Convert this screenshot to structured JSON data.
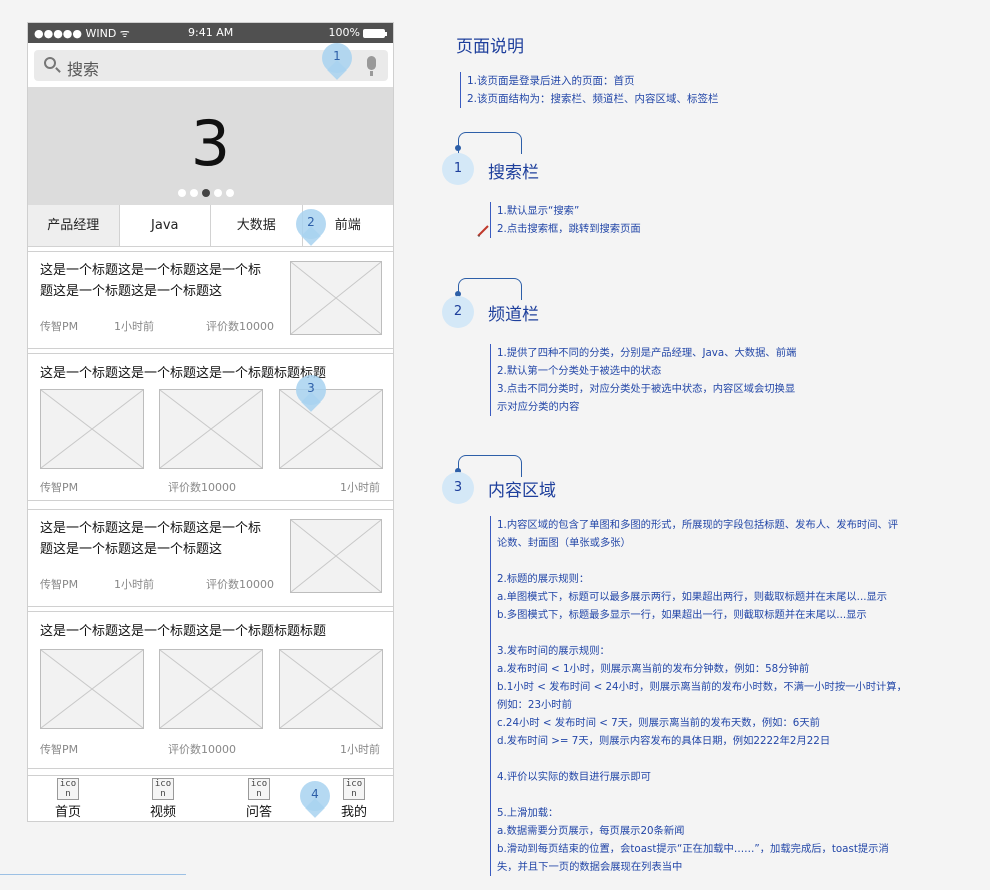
{
  "status_bar": {
    "carrier": "●●●●● WIND ᯤ",
    "time": "9:41 AM",
    "battery": "100%"
  },
  "search": {
    "placeholder": "搜索"
  },
  "banner": {
    "number": "3",
    "dots_total": 5,
    "active_dot": 2
  },
  "tabs": [
    {
      "label": "产品经理",
      "active": true
    },
    {
      "label": "Java",
      "active": false
    },
    {
      "label": "大数据",
      "active": false
    },
    {
      "label": "前端",
      "active": false
    }
  ],
  "cards": [
    {
      "type": "single",
      "title_line1": "这是一个标题这是一个标题这是一个标",
      "title_line2": "题这是一个标题这是一个标题这",
      "author": "传智PM",
      "time": "1小时前",
      "comments": "评价数10000"
    },
    {
      "type": "multi",
      "title": "这是一个标题这是一个标题这是一个标题标题标题",
      "author": "传智PM",
      "comments": "评价数10000",
      "time": "1小时前"
    },
    {
      "type": "single",
      "title_line1": "这是一个标题这是一个标题这是一个标",
      "title_line2": "题这是一个标题这是一个标题这",
      "author": "传智PM",
      "time": "1小时前",
      "comments": "评价数10000"
    },
    {
      "type": "multi",
      "title": "这是一个标题这是一个标题这是一个标题标题标题",
      "author": "传智PM",
      "comments": "评价数10000",
      "time": "1小时前"
    }
  ],
  "bottom_nav": [
    {
      "icon_text_1": "ico",
      "icon_text_2": "n",
      "label": "首页"
    },
    {
      "icon_text_1": "ico",
      "icon_text_2": "n",
      "label": "视频"
    },
    {
      "icon_text_1": "ico",
      "icon_text_2": "n",
      "label": "问答"
    },
    {
      "icon_text_1": "ico",
      "icon_text_2": "n",
      "label": "我的"
    }
  ],
  "markers": [
    "1",
    "2",
    "3",
    "4"
  ],
  "notes": {
    "title": "页面说明",
    "intro": "1.该页面是登录后进入的页面：首页\n2.该页面结构为：搜索栏、频道栏、内容区域、标签栏",
    "sections": [
      {
        "num": "1",
        "heading": "搜索栏",
        "body": "1.默认显示“搜索”\n2.点击搜索框，跳转到搜索页面"
      },
      {
        "num": "2",
        "heading": "频道栏",
        "body": "1.提供了四种不同的分类，分别是产品经理、Java、大数据、前端\n2.默认第一个分类处于被选中的状态\n3.点击不同分类时，对应分类处于被选中状态，内容区域会切换显\n示对应分类的内容"
      },
      {
        "num": "3",
        "heading": "内容区域",
        "body": "1.内容区域的包含了单图和多图的形式，所展现的字段包括标题、发布人、发布时间、评\n论数、封面图（单张或多张）\n \n2.标题的展示规则：\na.单图模式下，标题可以最多展示两行，如果超出两行，则截取标题并在末尾以...显示\nb.多图模式下，标题最多显示一行，如果超出一行，则截取标题并在末尾以...显示\n \n3.发布时间的展示规则：\na.发布时间 < 1小时，则展示离当前的发布分钟数，例如：58分钟前\nb.1小时 < 发布时间 < 24小时，则展示离当前的发布小时数，不满一小时按一小时计算，\n例如：23小时前\nc.24小时 < 发布时间 < 7天，则展示离当前的发布天数，例如：6天前\nd.发布时间 >= 7天，则展示内容发布的具体日期，例如2222年2月22日\n \n4.评价以实际的数目进行展示即可\n \n5.上滑加载：\na.数据需要分页展示，每页展示20条新闻\nb.滑动到每页结束的位置，会toast提示“正在加载中……”，加载完成后，toast提示消\n失，并且下一页的数据会展现在列表当中"
      }
    ]
  }
}
